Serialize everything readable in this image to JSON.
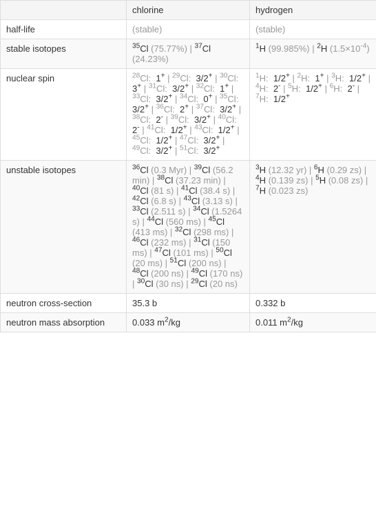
{
  "header": {
    "col1": "chlorine",
    "col2": "hydrogen"
  },
  "rows": {
    "half_life": {
      "label": "half-life",
      "chlorine": "(stable)",
      "hydrogen": "(stable)"
    },
    "stable_isotopes": {
      "label": "stable isotopes",
      "chlorine": [
        {
          "sup": "35",
          "sym": "Cl",
          "note": "(75.77%)"
        },
        {
          "sep": " | "
        },
        {
          "sup": "37",
          "sym": "Cl",
          "note": "(24.23%)"
        }
      ],
      "hydrogen": [
        {
          "sup": "1",
          "sym": "H",
          "note": "(99.985%)"
        },
        {
          "sep": " | "
        },
        {
          "sup": "2",
          "sym": "H",
          "note": "(1.5×10^-4)"
        }
      ]
    },
    "nuclear_spin": {
      "label": "nuclear spin",
      "chlorine": [
        {
          "sup": "28",
          "sym": "Cl",
          "spin": "1",
          "sign": "+"
        },
        {
          "sep": " | "
        },
        {
          "sup": "29",
          "sym": "Cl",
          "spin": "3/2",
          "sign": "+"
        },
        {
          "sep": " | "
        },
        {
          "sup": "30",
          "sym": "Cl",
          "spin": "3",
          "sign": "+"
        },
        {
          "sep": " | "
        },
        {
          "sup": "31",
          "sym": "Cl",
          "spin": "3/2",
          "sign": "+"
        },
        {
          "sep": " | "
        },
        {
          "sup": "32",
          "sym": "Cl",
          "spin": "1",
          "sign": "+"
        },
        {
          "sep": " | "
        },
        {
          "sup": "33",
          "sym": "Cl",
          "spin": "3/2",
          "sign": "+"
        },
        {
          "sep": " | "
        },
        {
          "sup": "34",
          "sym": "Cl",
          "spin": "0",
          "sign": "+"
        },
        {
          "sep": " | "
        },
        {
          "sup": "35",
          "sym": "Cl",
          "spin": "3/2",
          "sign": "+"
        },
        {
          "sep": " | "
        },
        {
          "sup": "36",
          "sym": "Cl",
          "spin": "2",
          "sign": "+"
        },
        {
          "sep": " | "
        },
        {
          "sup": "37",
          "sym": "Cl",
          "spin": "3/2",
          "sign": "+"
        },
        {
          "sep": " | "
        },
        {
          "sup": "38",
          "sym": "Cl",
          "spin": "2",
          "sign": "-"
        },
        {
          "sep": " | "
        },
        {
          "sup": "39",
          "sym": "Cl",
          "spin": "3/2",
          "sign": "+"
        },
        {
          "sep": " | "
        },
        {
          "sup": "40",
          "sym": "Cl",
          "spin": "2",
          "sign": "-"
        },
        {
          "sep": " | "
        },
        {
          "sup": "41",
          "sym": "Cl",
          "spin": "1/2",
          "sign": "+"
        },
        {
          "sep": " | "
        },
        {
          "sup": "43",
          "sym": "Cl",
          "spin": "1/2",
          "sign": "+"
        },
        {
          "sep": " | "
        },
        {
          "sup": "45",
          "sym": "Cl",
          "spin": "1/2",
          "sign": "+"
        },
        {
          "sep": " | "
        },
        {
          "sup": "47",
          "sym": "Cl",
          "spin": "3/2",
          "sign": "+"
        },
        {
          "sep": " | "
        },
        {
          "sup": "49",
          "sym": "Cl",
          "spin": "3/2",
          "sign": "+"
        },
        {
          "sep": " | "
        },
        {
          "sup": "51",
          "sym": "Cl",
          "spin": "3/2",
          "sign": "+"
        }
      ],
      "hydrogen": [
        {
          "sup": "1",
          "sym": "H",
          "spin": "1/2",
          "sign": "+"
        },
        {
          "sep": " | "
        },
        {
          "sup": "2",
          "sym": "H",
          "spin": "1",
          "sign": "+"
        },
        {
          "sep": " | "
        },
        {
          "sup": "3",
          "sym": "H",
          "spin": "1/2",
          "sign": "+"
        },
        {
          "sep": " | "
        },
        {
          "sup": "4",
          "sym": "H",
          "spin": "2",
          "sign": "-"
        },
        {
          "sep": " | "
        },
        {
          "sup": "5",
          "sym": "H",
          "spin": "1/2",
          "sign": "+"
        },
        {
          "sep": " | "
        },
        {
          "sup": "6",
          "sym": "H",
          "spin": "2",
          "sign": "-"
        },
        {
          "sep": " | "
        },
        {
          "sup": "7",
          "sym": "H",
          "spin": "1/2",
          "sign": "+"
        }
      ]
    },
    "unstable_isotopes": {
      "label": "unstable isotopes",
      "chlorine": [
        {
          "sup": "36",
          "sym": "Cl",
          "note": "(0.3 Myr)"
        },
        {
          "sep": " | "
        },
        {
          "sup": "39",
          "sym": "Cl",
          "note": "(56.2 min)"
        },
        {
          "sep": " | "
        },
        {
          "sup": "38",
          "sym": "Cl",
          "note": "(37.23 min)"
        },
        {
          "sep": " | "
        },
        {
          "sup": "40",
          "sym": "Cl",
          "note": "(81 s)"
        },
        {
          "sep": " | "
        },
        {
          "sup": "41",
          "sym": "Cl",
          "note": "(38.4 s)"
        },
        {
          "sep": " | "
        },
        {
          "sup": "42",
          "sym": "Cl",
          "note": "(6.8 s)"
        },
        {
          "sep": " | "
        },
        {
          "sup": "43",
          "sym": "Cl",
          "note": "(3.13 s)"
        },
        {
          "sep": " | "
        },
        {
          "sup": "33",
          "sym": "Cl",
          "note": "(2.511 s)"
        },
        {
          "sep": " | "
        },
        {
          "sup": "34",
          "sym": "Cl",
          "note": "(1.5264 s)"
        },
        {
          "sep": " | "
        },
        {
          "sup": "44",
          "sym": "Cl",
          "note": "(560 ms)"
        },
        {
          "sep": " | "
        },
        {
          "sup": "45",
          "sym": "Cl",
          "note": "(413 ms)"
        },
        {
          "sep": " | "
        },
        {
          "sup": "32",
          "sym": "Cl",
          "note": "(298 ms)"
        },
        {
          "sep": " | "
        },
        {
          "sup": "46",
          "sym": "Cl",
          "note": "(232 ms)"
        },
        {
          "sep": " | "
        },
        {
          "sup": "31",
          "sym": "Cl",
          "note": "(150 ms)"
        },
        {
          "sep": " | "
        },
        {
          "sup": "47",
          "sym": "Cl",
          "note": "(101 ms)"
        },
        {
          "sep": " | "
        },
        {
          "sup": "50",
          "sym": "Cl",
          "note": "(20 ms)"
        },
        {
          "sep": " | "
        },
        {
          "sup": "51",
          "sym": "Cl",
          "note": "(200 ns)"
        },
        {
          "sep": " | "
        },
        {
          "sup": "48",
          "sym": "Cl",
          "note": "(200 ns)"
        },
        {
          "sep": " | "
        },
        {
          "sup": "49",
          "sym": "Cl",
          "note": "(170 ns)"
        },
        {
          "sep": " | "
        },
        {
          "sup": "30",
          "sym": "Cl",
          "note": "(30 ns)"
        },
        {
          "sep": " | "
        },
        {
          "sup": "29",
          "sym": "Cl",
          "note": "(20 ns)"
        }
      ],
      "hydrogen": [
        {
          "sup": "3",
          "sym": "H",
          "note": "(12.32 yr)"
        },
        {
          "sep": " | "
        },
        {
          "sup": "6",
          "sym": "H",
          "note": "(0.29 zs)"
        },
        {
          "sep": " | "
        },
        {
          "sup": "4",
          "sym": "H",
          "note": "(0.139 zs)"
        },
        {
          "sep": " | "
        },
        {
          "sup": "5",
          "sym": "H",
          "note": "(0.08 zs)"
        },
        {
          "sep": " | "
        },
        {
          "sup": "7",
          "sym": "H",
          "note": "(0.023 zs)"
        }
      ]
    },
    "neutron_cross_section": {
      "label": "neutron cross-section",
      "chlorine": "35.3 b",
      "hydrogen": "0.332 b"
    },
    "neutron_mass_absorption": {
      "label": "neutron mass absorption",
      "chlorine": "0.033 m^2/kg",
      "hydrogen": "0.011 m^2/kg"
    }
  }
}
